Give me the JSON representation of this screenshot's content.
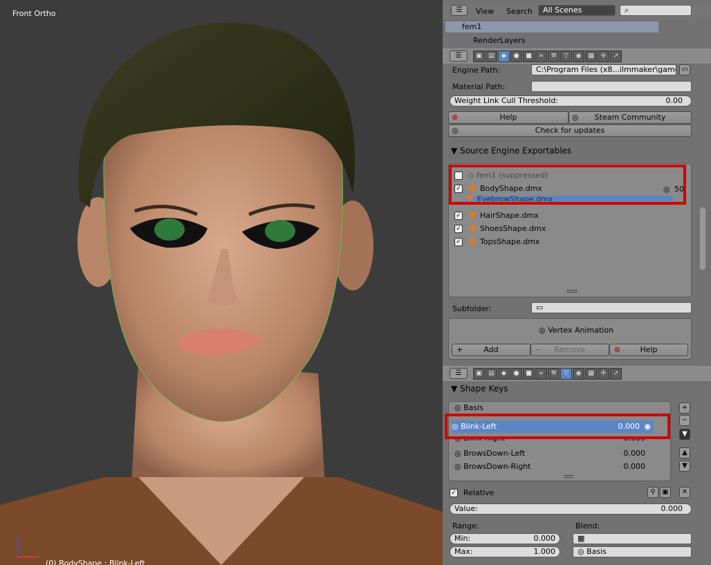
{
  "viewport": {
    "view_label": "Front Ortho",
    "status_label": "(0) BodyShape : Blink-Left"
  },
  "outliner": {
    "view_menu": "View",
    "search_menu": "Search",
    "scene_select": "All Scenes",
    "tree": [
      {
        "label": "fem1"
      },
      {
        "label": "RenderLayers"
      }
    ]
  },
  "source_panel": {
    "engine_path_label": "Engine Path:",
    "engine_path_value": "C:\\Program Files (x8...ilmmaker\\game\\bin\\",
    "material_path_label": "Material Path:",
    "material_path_value": "",
    "weight_cull_label": "Weight Link Cull Threshold:",
    "weight_cull_value": "0.00",
    "help_button": "Help",
    "steam_button": "Steam Community",
    "check_updates_button": "Check for updates",
    "exportables_header": "Source Engine Exportables",
    "exportables": [
      {
        "label": "fem1 (suppressed)",
        "checked": false
      },
      {
        "label": "BodyShape.dmx",
        "checked": true,
        "count": "50"
      },
      {
        "label": "EyebrowShape.dmx",
        "checked": true
      },
      {
        "label": "HairShape.dmx",
        "checked": true
      },
      {
        "label": "ShoesShape.dmx",
        "checked": true
      },
      {
        "label": "TopsShape.dmx",
        "checked": true
      }
    ],
    "subfolder_label": "Subfolder:",
    "subfolder_value": "",
    "vertex_animation_label": "Vertex Animation",
    "add_button": "Add",
    "remove_button": "Remove",
    "help2_button": "Help"
  },
  "shape_panel": {
    "header": "Shape Keys",
    "keys": [
      {
        "name": "Basis",
        "value": ""
      },
      {
        "name": "Blink-Left",
        "value": "0.000"
      },
      {
        "name": "Blink-Right",
        "value": "0.000"
      },
      {
        "name": "BrowsDown-Left",
        "value": "0.000"
      },
      {
        "name": "BrowsDown-Right",
        "value": "0.000"
      }
    ],
    "relative_label": "Relative",
    "value_label": "Value:",
    "value": "0.000",
    "range_label": "Range:",
    "blend_label": "Blend:",
    "min_label": "Min:",
    "min_value": "0.000",
    "max_label": "Max:",
    "max_value": "1.000",
    "blend_value": "Basis"
  }
}
